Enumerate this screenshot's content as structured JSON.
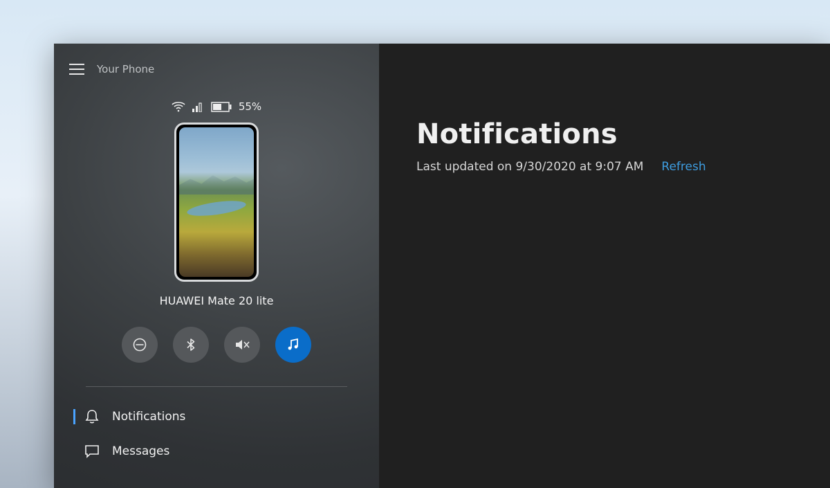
{
  "app": {
    "title": "Your Phone"
  },
  "phone": {
    "battery_text": "55%",
    "device_name": "HUAWEI Mate 20 lite"
  },
  "actions": {
    "dnd": "do-not-disturb",
    "bluetooth": "bluetooth",
    "mute": "mute",
    "music": "music"
  },
  "nav": {
    "items": [
      {
        "label": "Notifications",
        "icon": "bell",
        "selected": true
      },
      {
        "label": "Messages",
        "icon": "chat",
        "selected": false
      }
    ]
  },
  "main": {
    "title": "Notifications",
    "subtitle": "Last updated on 9/30/2020 at 9:07 AM",
    "refresh_label": "Refresh"
  }
}
